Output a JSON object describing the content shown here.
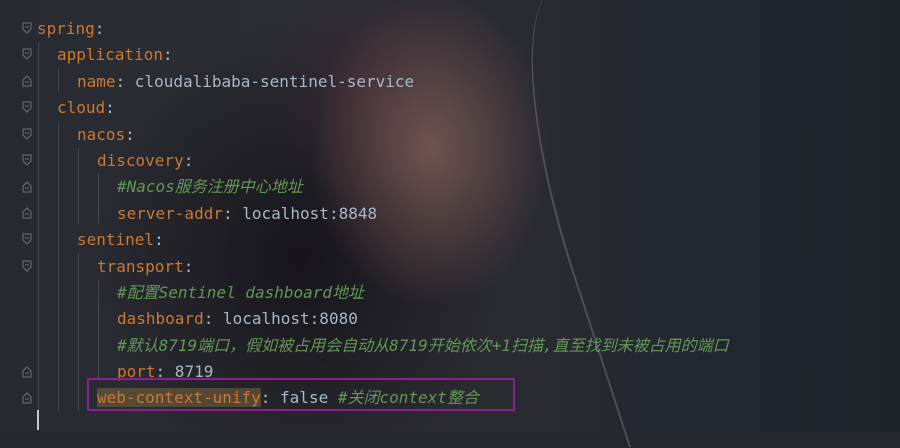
{
  "editor": {
    "lines": [
      {
        "indent": 0,
        "key": "spring",
        "sep": ":",
        "value": "",
        "comment": ""
      },
      {
        "indent": 1,
        "key": "application",
        "sep": ":",
        "value": "",
        "comment": ""
      },
      {
        "indent": 2,
        "key": "name",
        "sep": ":",
        "value": " cloudalibaba-sentinel-service",
        "comment": ""
      },
      {
        "indent": 1,
        "key": "cloud",
        "sep": ":",
        "value": "",
        "comment": ""
      },
      {
        "indent": 2,
        "key": "nacos",
        "sep": ":",
        "value": "",
        "comment": ""
      },
      {
        "indent": 3,
        "key": "discovery",
        "sep": ":",
        "value": "",
        "comment": ""
      },
      {
        "indent": 4,
        "key": "",
        "sep": "",
        "value": "",
        "comment": "#Nacos服务注册中心地址"
      },
      {
        "indent": 4,
        "key": "server-addr",
        "sep": ":",
        "value": " localhost:8848",
        "comment": ""
      },
      {
        "indent": 2,
        "key": "sentinel",
        "sep": ":",
        "value": "",
        "comment": ""
      },
      {
        "indent": 3,
        "key": "transport",
        "sep": ":",
        "value": "",
        "comment": ""
      },
      {
        "indent": 4,
        "key": "",
        "sep": "",
        "value": "",
        "comment": "#配置Sentinel dashboard地址"
      },
      {
        "indent": 4,
        "key": "dashboard",
        "sep": ":",
        "value": " localhost:8080",
        "comment": ""
      },
      {
        "indent": 4,
        "key": "",
        "sep": "",
        "value": "",
        "comment": "#默认8719端口，假如被占用会自动从8719开始依次+1扫描,直至找到未被占用的端口"
      },
      {
        "indent": 4,
        "key": "port",
        "sep": ":",
        "value": " 8719",
        "comment": ""
      },
      {
        "indent": 3,
        "key": "web-context-unify",
        "sep": ":",
        "value": " false ",
        "comment": "#关闭context整合"
      }
    ]
  },
  "colors": {
    "key": "#cc7832",
    "value": "#a9b7c6",
    "comment": "#629755",
    "annotation_box": "#8a1f8f"
  }
}
